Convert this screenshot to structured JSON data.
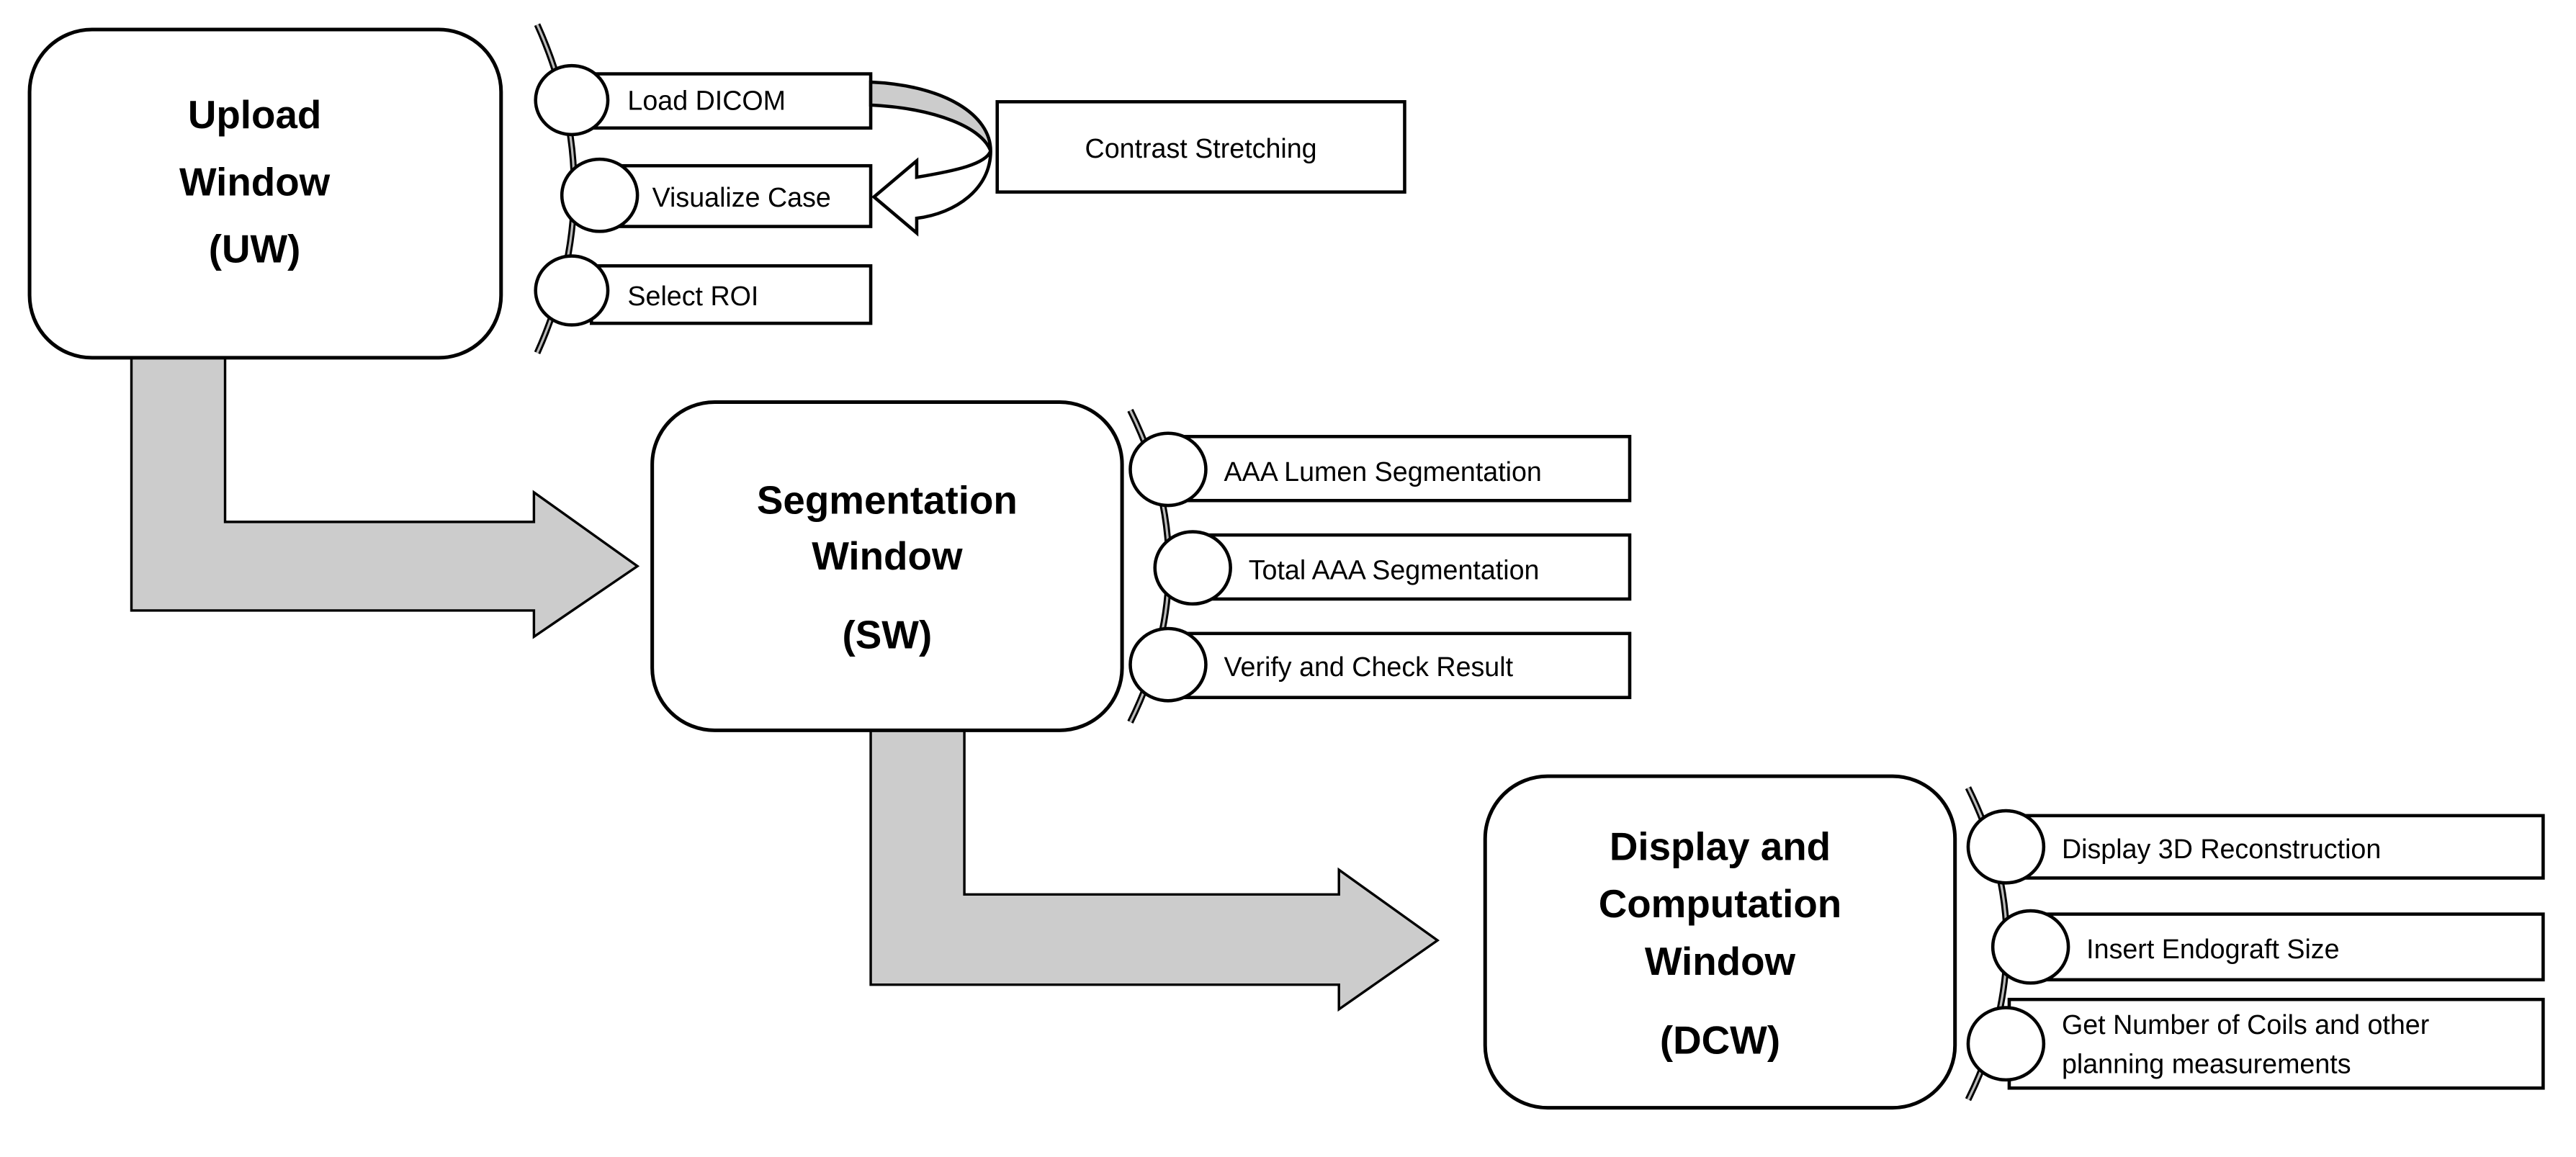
{
  "colors": {
    "arrow_fill": "#cccccc",
    "stroke": "#000000",
    "background": "#ffffff"
  },
  "windows": [
    {
      "title_lines": [
        "Upload",
        "Window",
        "(UW)"
      ],
      "items": [
        "Load DICOM",
        "Visualize Case",
        "Select ROI"
      ]
    },
    {
      "title_lines": [
        "Segmentation",
        "Window",
        "(SW)"
      ],
      "items": [
        "AAA Lumen Segmentation",
        "Total AAA Segmentation",
        "Verify and Check Result"
      ]
    },
    {
      "title_lines": [
        "Display and",
        "Computation",
        "Window",
        "(DCW)"
      ],
      "items": [
        "Display 3D Reconstruction",
        "Insert Endograft Size",
        "Get Number of Coils and other",
        "planning measurements"
      ]
    }
  ],
  "side_process": {
    "label": "Contrast Stretching"
  }
}
